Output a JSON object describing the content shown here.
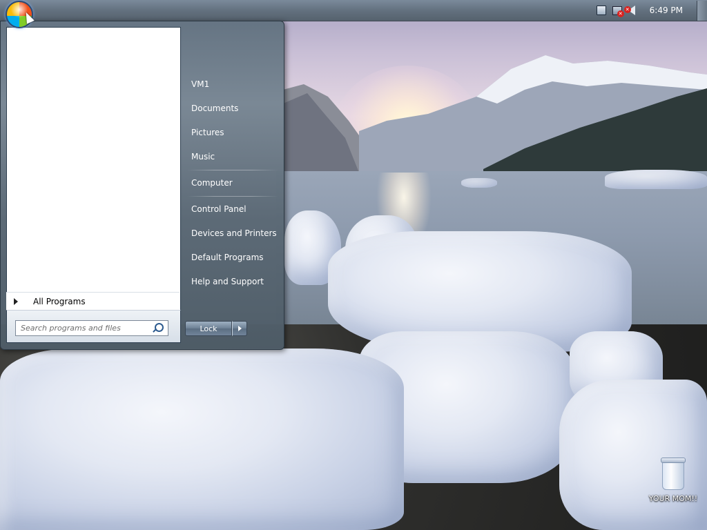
{
  "taskbar": {
    "clock": "6:49 PM",
    "start_orb_icon": "windows-orb-icon",
    "tray_icons": [
      "action-center-flag-icon",
      "network-disconnected-icon",
      "volume-muted-icon"
    ]
  },
  "start_menu": {
    "right_items": [
      {
        "label": "VM1"
      },
      {
        "label": "Documents"
      },
      {
        "label": "Pictures"
      },
      {
        "label": "Music"
      },
      {
        "label": "Computer"
      },
      {
        "label": "Control Panel"
      },
      {
        "label": "Devices and Printers"
      },
      {
        "label": "Default Programs"
      },
      {
        "label": "Help and Support"
      }
    ],
    "all_programs_label": "All Programs",
    "search_placeholder": "Search programs and files",
    "lock_label": "Lock"
  },
  "desktop": {
    "icons": [
      {
        "label": "YOUR MOM!!",
        "icon": "recycle-bin-icon"
      }
    ]
  },
  "colors": {
    "taskbar": "#63717f",
    "start_menu_glass": "#6e8292",
    "left_pane": "#ffffff"
  }
}
